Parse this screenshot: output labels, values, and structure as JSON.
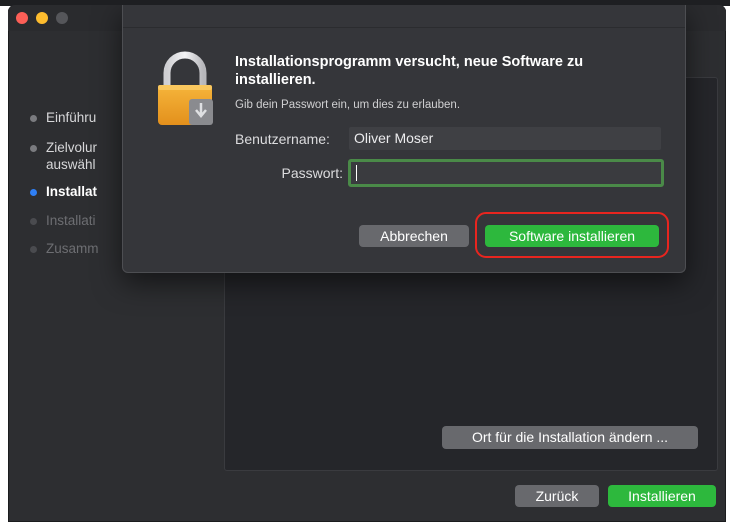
{
  "window": {
    "traffic_lights": [
      "close",
      "minimize",
      "zoom"
    ],
    "accent_color": "#2f7ff5",
    "primary_button_color": "#2db83d"
  },
  "sidebar": {
    "steps": [
      {
        "label": "Einführu",
        "state": "done"
      },
      {
        "label": "Zielvolur\nauswähl",
        "state": "done"
      },
      {
        "label": "Installat",
        "state": "current"
      },
      {
        "label": "Installati",
        "state": "pending"
      },
      {
        "label": "Zusamm",
        "state": "pending"
      }
    ]
  },
  "main": {
    "change_location_button": "Ort für die Installation ändern ...",
    "back_button": "Zurück",
    "install_button": "Installieren"
  },
  "auth_dialog": {
    "icon": "lock-icon",
    "title": "Installationsprogramm versucht, neue Software zu installieren.",
    "subtitle": "Gib dein Passwort ein, um dies zu erlauben.",
    "username_label": "Benutzername:",
    "username_value": "Oliver Moser",
    "password_label": "Passwort:",
    "password_value": "",
    "cancel_button": "Abbrechen",
    "confirm_button": "Software installieren",
    "highlight_color": "#e8251f"
  }
}
